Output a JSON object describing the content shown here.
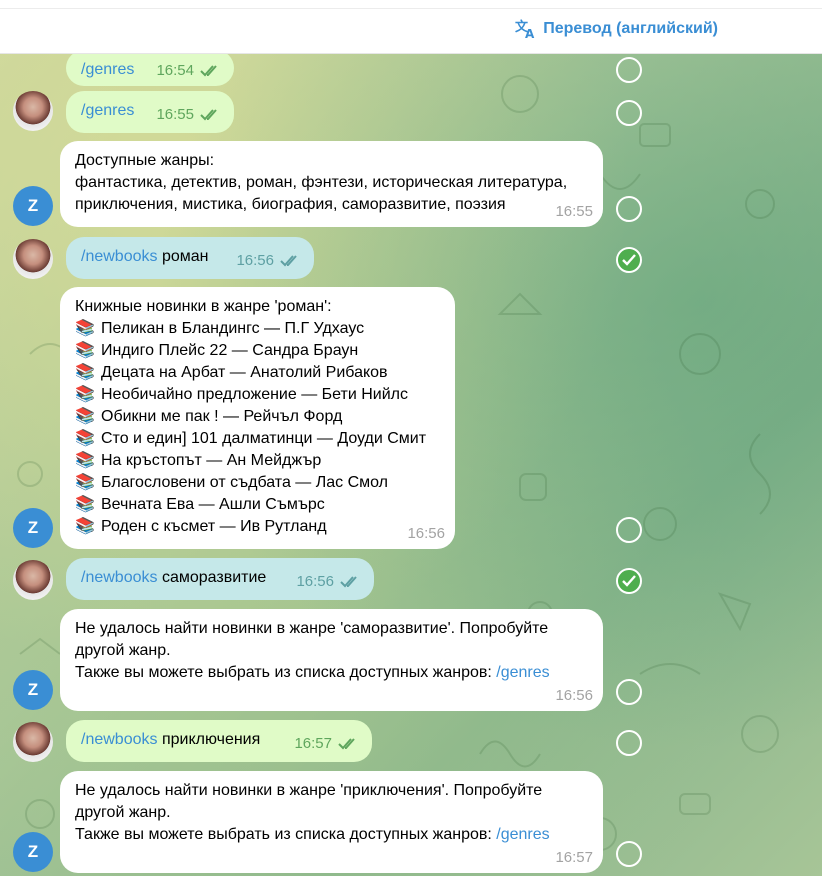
{
  "header": {
    "translate_label": "Перевод (английский)"
  },
  "avatars": {
    "bot_letter": "Z"
  },
  "messages": {
    "m1": {
      "text": "/genres",
      "time": "16:54"
    },
    "m2": {
      "text": "/genres",
      "time": "16:55"
    },
    "m3": {
      "line1": "Доступные жанры:",
      "line2": "фантастика, детектив, роман, фэнтези, историческая литература,",
      "line3": "приключения, мистика, биография, саморазвитие, поэзия",
      "time": "16:55"
    },
    "m4": {
      "command": "/newbooks",
      "arg": " роман",
      "time": "16:56"
    },
    "m5": {
      "title": "Книжные новинки в жанре 'роман':",
      "book_emoji": "📚",
      "books": [
        "Пеликан в Бландингс — П.Г Удхаус",
        "Индиго Плейс 22 — Сандра Браун",
        "Децата на Арбат — Анатолий Рибаков",
        "Необичайно предложение — Бети Нийлс",
        "Обикни ме пак ! — Рейчъл Форд",
        "Сто и един] 101 далматинци — Доуди Смит",
        "На кръстопът — Ан Мейджър",
        "Благословени от съдбата — Лас Смол",
        "Вечната Ева — Ашли Съмърс",
        "Роден с късмет — Ив Рутланд"
      ],
      "time": "16:56"
    },
    "m6": {
      "command": "/newbooks",
      "arg": " саморазвитие",
      "time": "16:56"
    },
    "m7": {
      "line1": "Не удалось найти новинки в жанре 'саморазвитие'. Попробуйте",
      "line2": "другой жанр.",
      "line3": "Также вы можете выбрать из списка доступных жанров: ",
      "link": "/genres",
      "time": "16:56"
    },
    "m8": {
      "command": "/newbooks",
      "arg": " приключения",
      "time": "16:57"
    },
    "m9": {
      "line1": "Не удалось найти новинки в жанре 'приключения'. Попробуйте",
      "line2": "другой жанр.",
      "line3": "Также вы можете выбрать из списка доступных жанров: ",
      "link": "/genres",
      "time": "16:57"
    }
  },
  "colors": {
    "accent": "#3a8ed4",
    "outgoing_bubble": "#e0fbc7",
    "selected_bubble": "#c5e8e9",
    "check_selected": "#4fae4e"
  },
  "selection": {
    "selected": [
      false,
      false,
      false,
      true,
      false,
      true,
      false,
      false,
      false
    ]
  }
}
